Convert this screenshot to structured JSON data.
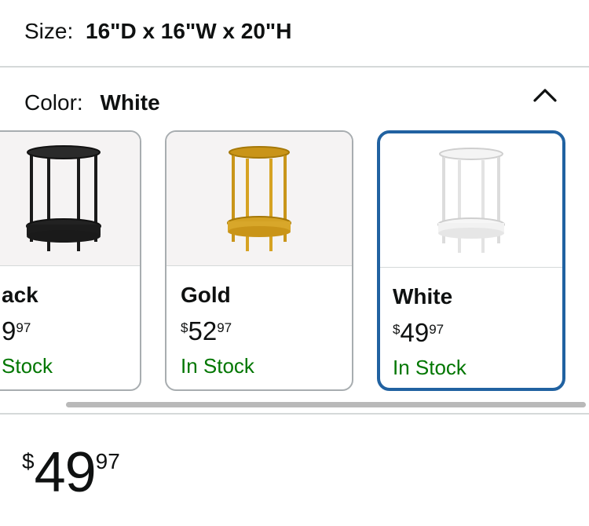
{
  "size": {
    "label": "Size:",
    "value": "16\"D x 16\"W x 20\"H"
  },
  "color": {
    "label": "Color:",
    "value": "White",
    "collapse_icon": "chevron-up-icon"
  },
  "swatches": [
    {
      "name": "ack",
      "price_symbol": "",
      "price_whole": "9",
      "price_fraction": "97",
      "stock": "Stock",
      "tone": "#1f1f1f",
      "selected": false
    },
    {
      "name": "Gold",
      "price_symbol": "$",
      "price_whole": "52",
      "price_fraction": "97",
      "stock": "In Stock",
      "tone": "#d9a520",
      "selected": false
    },
    {
      "name": "White",
      "price_symbol": "$",
      "price_whole": "49",
      "price_fraction": "97",
      "stock": "In Stock",
      "tone": "#f7f7f7",
      "selected": true
    }
  ],
  "price": {
    "symbol": "$",
    "whole": "49",
    "fraction": "97"
  },
  "colors": {
    "selected_border": "#2162a1",
    "in_stock": "#007600",
    "divider": "#d5d9d9"
  }
}
